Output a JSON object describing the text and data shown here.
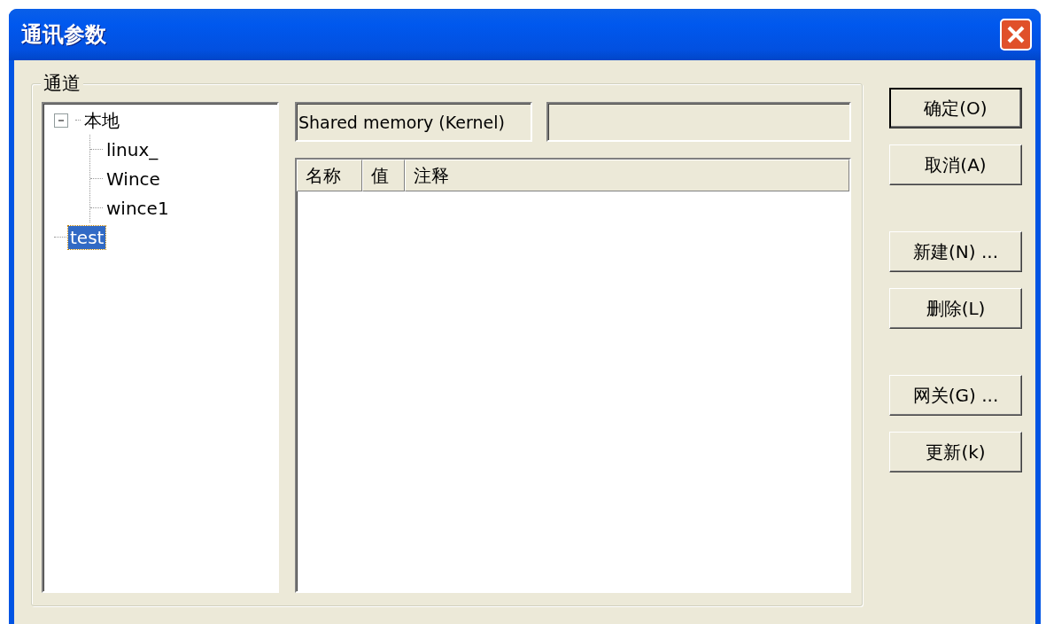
{
  "window": {
    "title": "通讯参数"
  },
  "group": {
    "label": "通道"
  },
  "tree": [
    {
      "label": "本地",
      "expanded": true,
      "selected": false,
      "children": [
        {
          "label": "linux_",
          "selected": false
        },
        {
          "label": "Wince",
          "selected": false
        },
        {
          "label": "wince1",
          "selected": false
        }
      ]
    },
    {
      "label": "test",
      "selected": true
    }
  ],
  "type_field": {
    "value": "Shared memory (Kernel)"
  },
  "list": {
    "columns": [
      "名称",
      "值",
      "注释"
    ]
  },
  "buttons": [
    {
      "label": "确定(O)",
      "default": true
    },
    {
      "label": "取消(A)",
      "default": false
    },
    {
      "label": "新建(N) ...",
      "default": false
    },
    {
      "label": "删除(L)",
      "default": false
    },
    {
      "label": "网关(G) ...",
      "default": false
    },
    {
      "label": "更新(k)",
      "default": false
    }
  ]
}
